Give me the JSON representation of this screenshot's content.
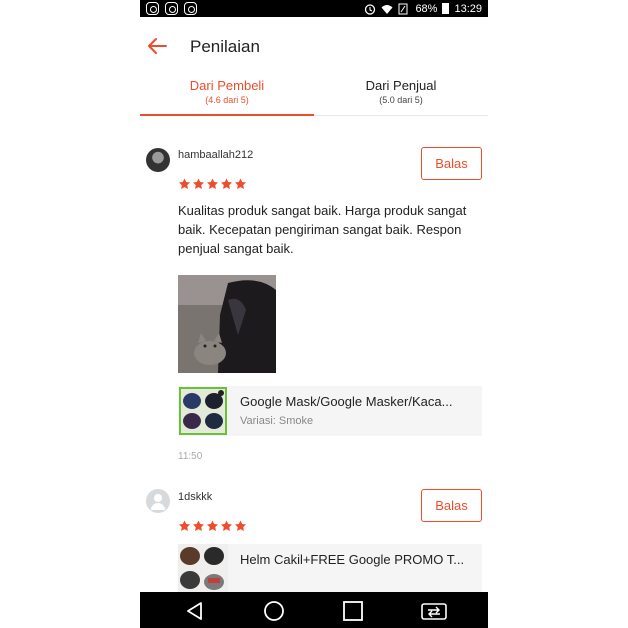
{
  "status_bar": {
    "left_icons": [
      "instagram-icon",
      "instagram-icon",
      "instagram-icon"
    ],
    "battery": "68%",
    "time": "13:29"
  },
  "header": {
    "title": "Penilaian"
  },
  "tabs": [
    {
      "label": "Dari Pembeli",
      "sub": "(4.6 dari 5)",
      "active": true
    },
    {
      "label": "Dari Penjual",
      "sub": "(5.0 dari 5)",
      "active": false
    }
  ],
  "reviews": [
    {
      "username": "hambaallah212",
      "reply_label": "Balas",
      "rating": 5,
      "comment": "Kualitas produk sangat baik. Harga produk sangat baik. Kecepatan pengiriman sangat baik. Respon penjual sangat baik.",
      "product_name": "Google Mask/Google Masker/Kaca...",
      "product_variant": "Variasi: Smoke",
      "time": "11:50"
    },
    {
      "username": "1dskkk",
      "reply_label": "Balas",
      "rating": 5,
      "product_name": "Helm Cakil+FREE Google PROMO T..."
    }
  ],
  "colors": {
    "accent": "#ee4d2d",
    "text": "#222222",
    "muted": "#888888"
  }
}
